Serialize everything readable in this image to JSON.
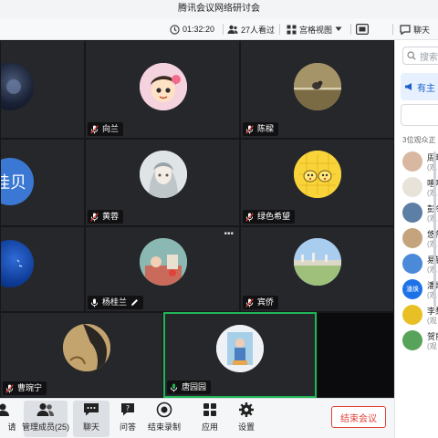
{
  "window": {
    "title": "腾讯会议网络研讨会"
  },
  "toolbar": {
    "duration": "01:32:20",
    "viewers": "27人看过",
    "view_mode": "宫格视图",
    "chat_label": "聊天"
  },
  "tiles": [
    {
      "name": "",
      "show_tag": false
    },
    {
      "name": "向兰",
      "show_tag": true
    },
    {
      "name": "陈樑",
      "show_tag": true
    },
    {
      "name": "",
      "show_tag": false,
      "avatar_text": "桂贝"
    },
    {
      "name": "黄蓉",
      "show_tag": true
    },
    {
      "name": "绿色希望",
      "show_tag": true
    },
    {
      "name": "",
      "show_tag": false
    },
    {
      "name": "杨桂兰",
      "show_tag": true
    },
    {
      "name": "宾侨",
      "show_tag": true
    },
    {
      "name": "曹琬宁",
      "show_tag": true
    },
    {
      "name": "唐园园",
      "show_tag": true
    },
    {
      "name": "",
      "show_tag": false
    }
  ],
  "bottombar": {
    "invite": "请",
    "members": "管理成员(25)",
    "chat": "聊天",
    "qa": "问答",
    "record": "结束录制",
    "apps": "应用",
    "settings": "设置",
    "end_meeting": "结束会议"
  },
  "sidepanel": {
    "search_placeholder": "搜索",
    "tab_label": "有主",
    "count_text": "3位观众正",
    "attendees": [
      {
        "name": "周晓",
        "role": "(观"
      },
      {
        "name": "嘻嘻",
        "role": "(观"
      },
      {
        "name": "彭冬",
        "role": "(观"
      },
      {
        "name": "悠然",
        "role": "(观"
      },
      {
        "name": "易银",
        "role": "(观"
      },
      {
        "name": "潘焕",
        "role": "(观",
        "avatar_text": "潘焕"
      },
      {
        "name": "李梨",
        "role": "(观"
      },
      {
        "name": "贺丽",
        "role": "(观"
      }
    ]
  },
  "colors": {
    "active_speaker_border": "#22b558",
    "end_meeting": "#e0423a",
    "accent_blue": "#1a5fd0"
  }
}
